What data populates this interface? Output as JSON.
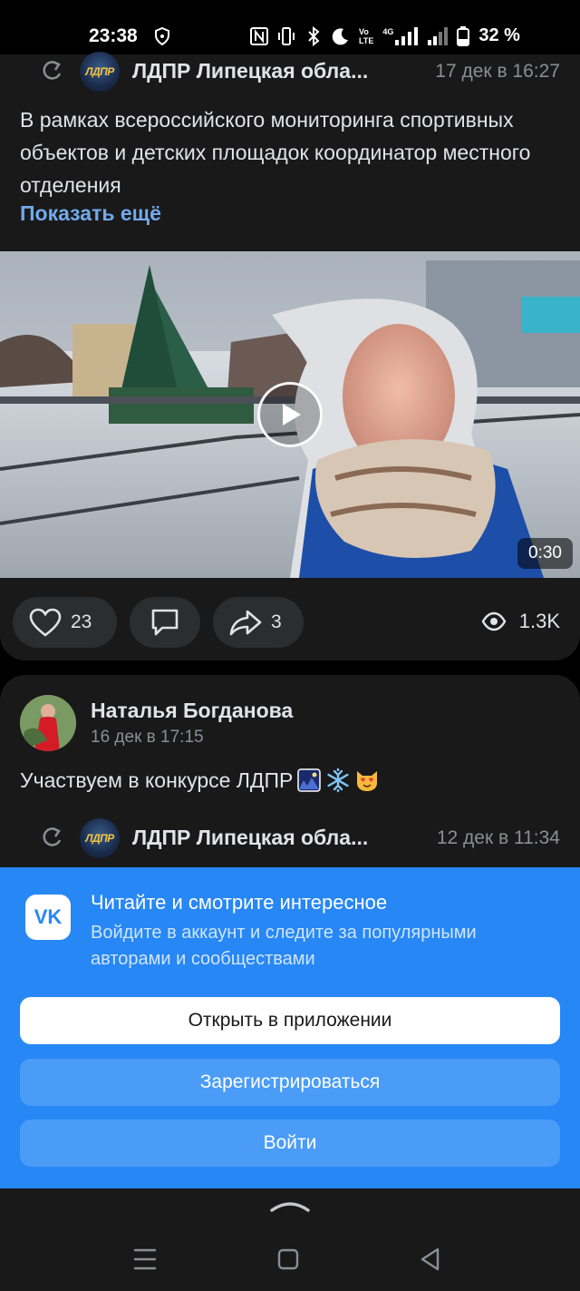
{
  "status_bar": {
    "time": "23:38",
    "battery": "32 %",
    "volte_line1": "Vo",
    "volte_line2": "LTE",
    "network": "4G",
    "icons": [
      "shield-icon",
      "nfc-icon",
      "vibrate-icon",
      "bluetooth-icon",
      "moon-icon",
      "signal-icon",
      "battery-icon"
    ]
  },
  "post1": {
    "repost": {
      "group_name": "ЛДПР Липецкая обла...",
      "avatar_text": "ЛДПР",
      "date": "17 дек в 16:27"
    },
    "text": "В рамках всероссийского мониторинга спортивных объектов и детских площадок координатор местного отделения",
    "show_more": "Показать ещё",
    "video": {
      "duration": "0:30"
    },
    "actions": {
      "likes": "23",
      "comments": "",
      "shares": "3",
      "views": "1.3K"
    }
  },
  "post2": {
    "author": "Наталья Богданова",
    "date": "16 дек в 17:15",
    "text": "Участвуем в конкурсе ЛДПР",
    "repost": {
      "group_name": "ЛДПР Липецкая обла...",
      "avatar_text": "ЛДПР",
      "date": "12 дек в 11:34"
    }
  },
  "sheet": {
    "logo": "VK",
    "title": "Читайте и смотрите интересное",
    "subtitle": "Войдите в аккаунт и следите за популярными авторами и сообществами",
    "open_app": "Открыть в приложении",
    "register": "Зарегистрироваться",
    "login": "Войти"
  },
  "colors": {
    "accent": "#2787f5",
    "link": "#71aaeb",
    "card_bg": "#19191a",
    "pill_bg": "#2c2d2e"
  }
}
